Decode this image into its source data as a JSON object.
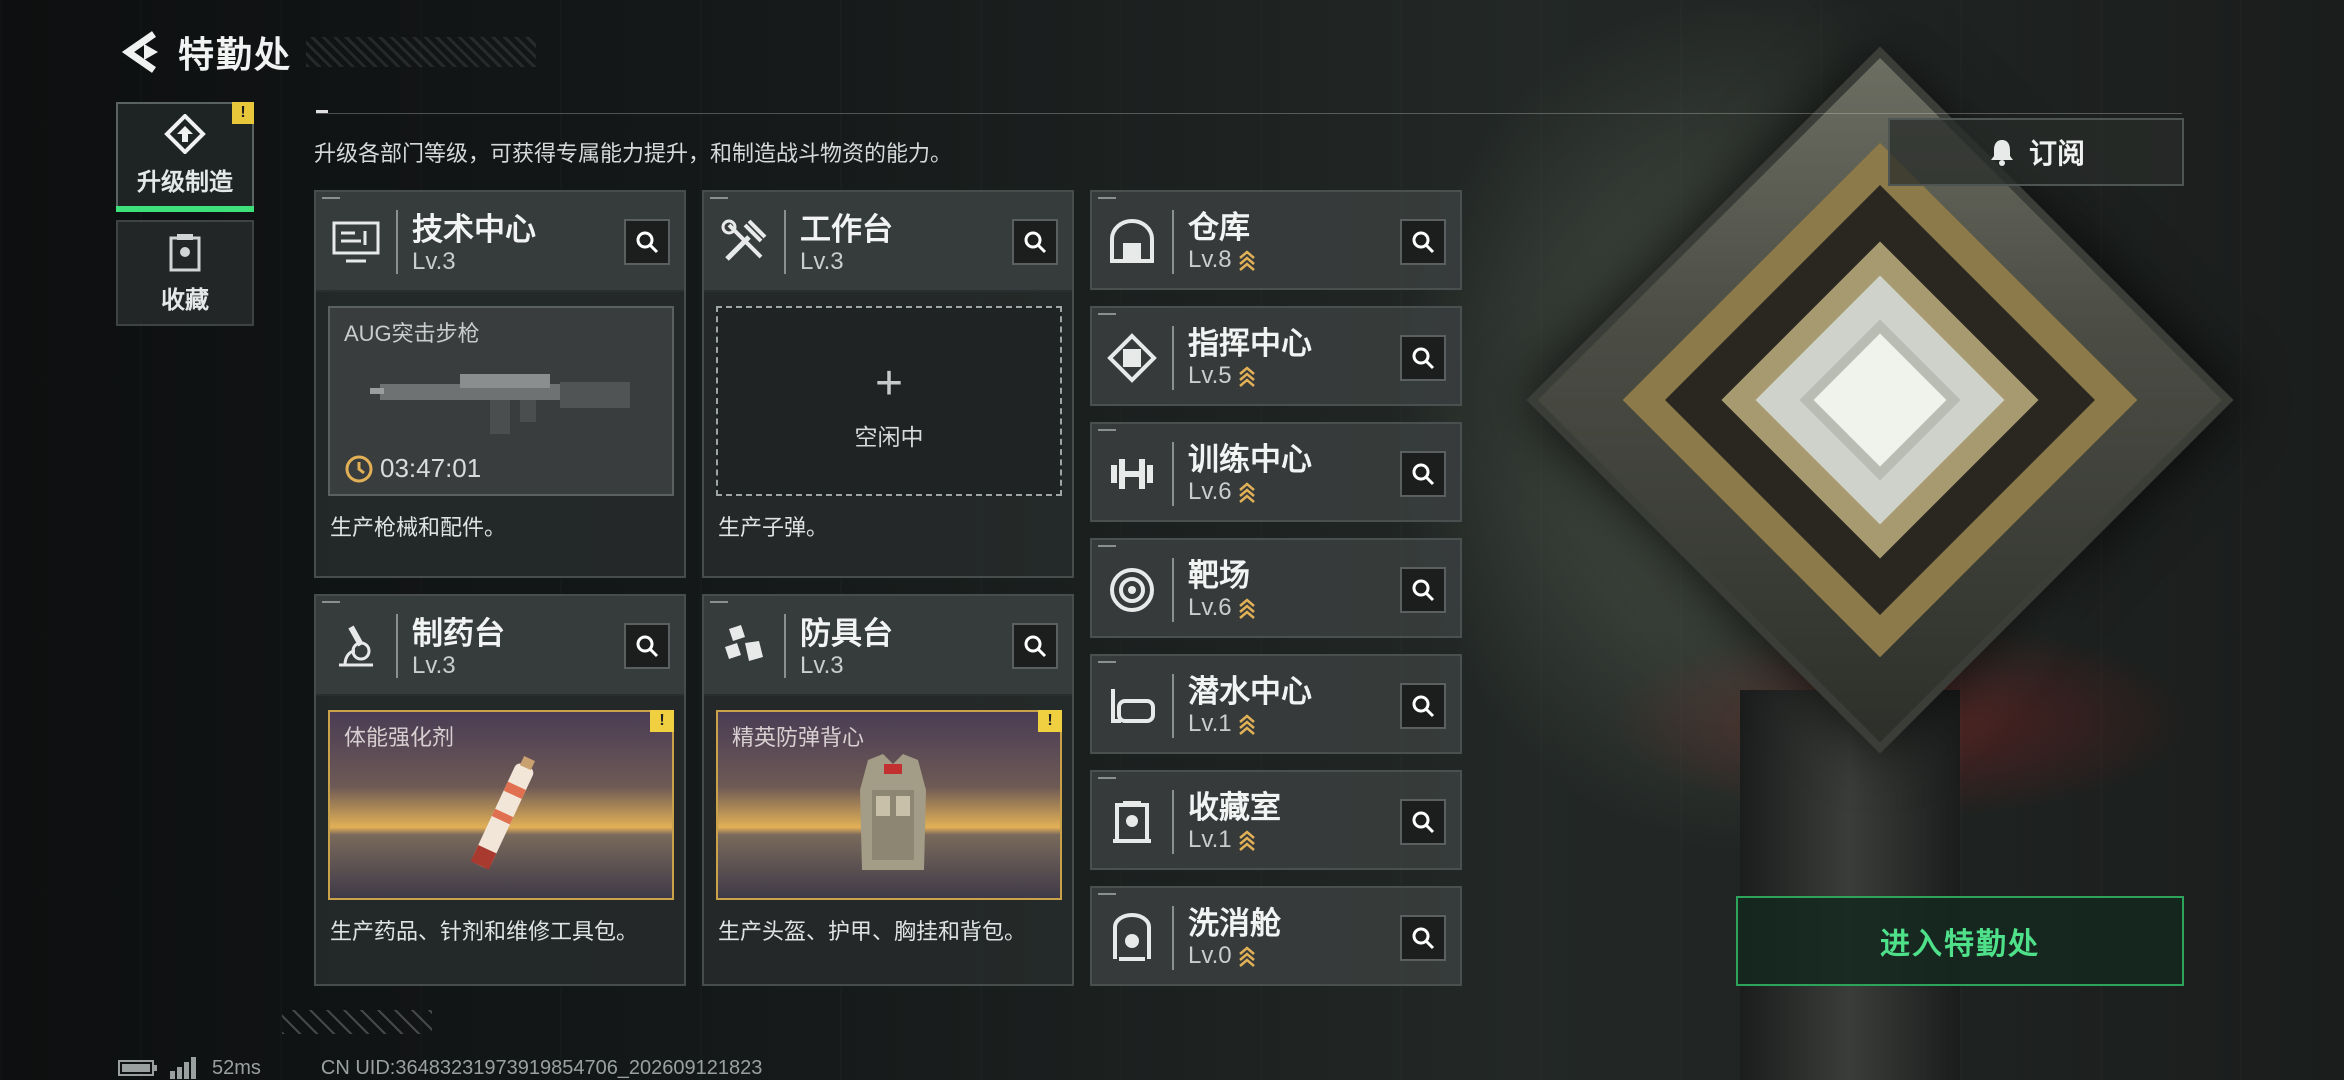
{
  "header": {
    "title": "特勤处"
  },
  "nav": {
    "items": [
      {
        "label": "升级制造",
        "badge": "!",
        "active": true
      },
      {
        "label": "收藏",
        "active": false
      }
    ]
  },
  "description": "升级各部门等级，可获得专属能力提升，和制造战斗物资的能力。",
  "subscribe": {
    "label": "订阅"
  },
  "production_cards": [
    {
      "name": "技术中心",
      "level": "Lv.3",
      "slot_title": "AUG突击步枪",
      "timer": "03:47:01",
      "desc": "生产枪械和配件。"
    },
    {
      "name": "工作台",
      "level": "Lv.3",
      "slot_state": "空闲中",
      "plus": "+",
      "desc": "生产子弹。"
    },
    {
      "name": "制药台",
      "level": "Lv.3",
      "slot_title": "体能强化剂",
      "badge": "!",
      "desc": "生产药品、针剂和维修工具包。"
    },
    {
      "name": "防具台",
      "level": "Lv.3",
      "slot_title": "精英防弹背心",
      "badge": "!",
      "desc": "生产头盔、护甲、胸挂和背包。"
    }
  ],
  "facilities": [
    {
      "name": "仓库",
      "level": "Lv.8"
    },
    {
      "name": "指挥中心",
      "level": "Lv.5"
    },
    {
      "name": "训练中心",
      "level": "Lv.6"
    },
    {
      "name": "靶场",
      "level": "Lv.6"
    },
    {
      "name": "潜水中心",
      "level": "Lv.1"
    },
    {
      "name": "收藏室",
      "level": "Lv.1"
    },
    {
      "name": "洗消舱",
      "level": "Lv.0"
    }
  ],
  "enter_button": {
    "label": "进入特勤处"
  },
  "footer": {
    "ping": "52ms",
    "uid": "CN UID:36483231973919854706_202609121823"
  },
  "colors": {
    "accent_green": "#3ee07a",
    "warning_yellow": "#f0d040",
    "upgrade_gold": "#e2b057"
  }
}
